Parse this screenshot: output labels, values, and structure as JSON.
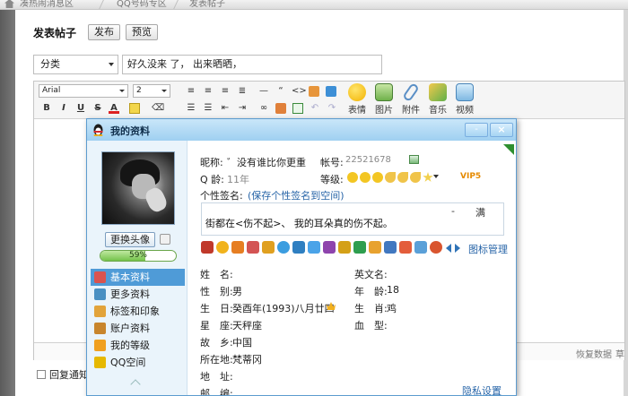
{
  "breadcrumb": [
    "凑热闹消息区",
    "QQ号码专区",
    "发表帖子"
  ],
  "post": {
    "title": "发表帖子",
    "publish_button": "发布",
    "preview_button": "预览",
    "category_value": "分类",
    "subject_value": "好久没来 了， 出来晒晒，"
  },
  "editor": {
    "font_name": "Arial",
    "font_size": "2",
    "tools": [
      "表情",
      "图片",
      "附件",
      "音乐",
      "视频"
    ],
    "restore_data": "恢复数据",
    "draft": "草"
  },
  "reply_notify": "回复通知",
  "profile_dialog": {
    "title": "我的资料",
    "minimize": "-",
    "close": "×",
    "change_avatar_button": "更换头像",
    "level_percent": "59%",
    "level_fraction": 0.59,
    "nav": [
      {
        "label": "基本资料",
        "icon": "profile-card-icon",
        "color": "#d9534f"
      },
      {
        "label": "更多资料",
        "icon": "more-info-icon",
        "color": "#4a90c2"
      },
      {
        "label": "标签和印象",
        "icon": "tag-icon",
        "color": "#e2a33a"
      },
      {
        "label": "账户资料",
        "icon": "account-icon",
        "color": "#c8852c"
      },
      {
        "label": "我的等级",
        "icon": "level-star-icon",
        "color": "#f0a020"
      },
      {
        "label": "QQ空间",
        "icon": "qzone-icon",
        "color": "#e6b800"
      }
    ],
    "nickname_label": "昵称:",
    "nickname_value": "゛没有谁比你更重",
    "account_label": "帐号:",
    "account_value": "22521678",
    "qq_age_label": "Q 龄:",
    "qq_age_value": "11年",
    "level_label": "等级:",
    "vip_text": "VIP5",
    "signature_label": "个性签名:",
    "signature_link": "(保存个性签名到空间)",
    "signature_text": "街都在<伤不起>、 我的耳朵真的伤不起。",
    "signature_dash": "-",
    "signature_end": "满",
    "icon_manage": "图标管理",
    "fields_left": [
      {
        "label": "姓　名:",
        "value": ""
      },
      {
        "label": "性　别:",
        "value": "男"
      },
      {
        "label": "生　日:",
        "value": "癸酉年(1993)八月廿四"
      },
      {
        "label": "星　座:",
        "value": "天秤座"
      },
      {
        "label": "故　乡:",
        "value": "中国"
      },
      {
        "label": "所在地:",
        "value": "梵蒂冈"
      },
      {
        "label": "地　址:",
        "value": ""
      },
      {
        "label": "邮　编:",
        "value": ""
      }
    ],
    "fields_right": [
      {
        "label": "英文名:",
        "value": ""
      },
      {
        "label": "年　龄:",
        "value": "18"
      },
      {
        "label": "生　肖:",
        "value": "鸡"
      },
      {
        "label": "血　型:",
        "value": ""
      }
    ],
    "privacy_link": "隐私设置"
  }
}
